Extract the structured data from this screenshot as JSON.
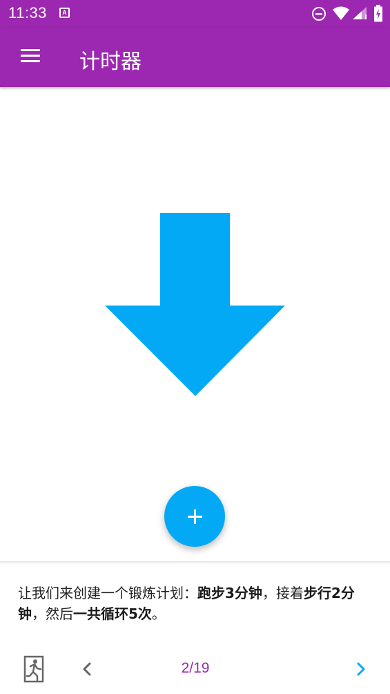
{
  "status_bar": {
    "time": "11:33",
    "notification_icon_letter": "A",
    "icons": [
      "notification-a-icon",
      "do-not-disturb-icon",
      "wifi-icon",
      "signal-icon",
      "battery-charging-icon"
    ]
  },
  "app_bar": {
    "title": "计时器",
    "menu_icon": "hamburger-menu-icon"
  },
  "colors": {
    "primary": "#9c27b0",
    "accent": "#03a9f4",
    "text": "#222222"
  },
  "illustration": {
    "icon": "down-arrow-icon"
  },
  "fab": {
    "icon": "plus-icon"
  },
  "tutorial": {
    "parts": [
      {
        "text": "让我们来创建一个锻炼计划：",
        "bold": false
      },
      {
        "text": "跑步3分钟",
        "bold": true
      },
      {
        "text": "，接着",
        "bold": false
      },
      {
        "text": "步行2分钟",
        "bold": true
      },
      {
        "text": "，然后",
        "bold": false
      },
      {
        "text": "一共循环5次",
        "bold": true
      },
      {
        "text": "。",
        "bold": false
      }
    ]
  },
  "nav": {
    "page_indicator": "2/19",
    "exit_icon": "exit-tutorial-icon",
    "prev_icon": "chevron-left-icon",
    "next_icon": "chevron-right-icon"
  }
}
